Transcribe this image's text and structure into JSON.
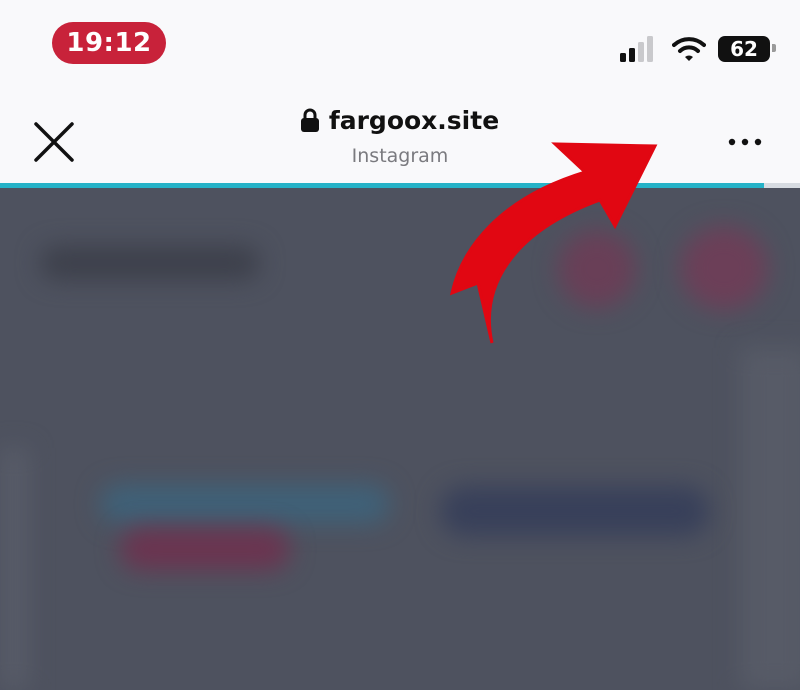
{
  "status_bar": {
    "time": "19:12",
    "battery_percent": "62",
    "icons": [
      "cellular-signal-icon",
      "wifi-icon",
      "battery-icon"
    ]
  },
  "browser": {
    "domain": "fargoox.site",
    "subtitle": "Instagram",
    "close_icon": "close-icon",
    "lock_icon": "lock-icon",
    "more_icon": "more-options-icon",
    "load_progress": 0.955
  },
  "annotation": {
    "arrow_icon": "red-curved-arrow-icon",
    "arrow_color": "#e10712"
  },
  "colors": {
    "time_pill": "#c8223a",
    "progress_bar": "#25b2c7",
    "content_overlay": "#4e525f"
  }
}
